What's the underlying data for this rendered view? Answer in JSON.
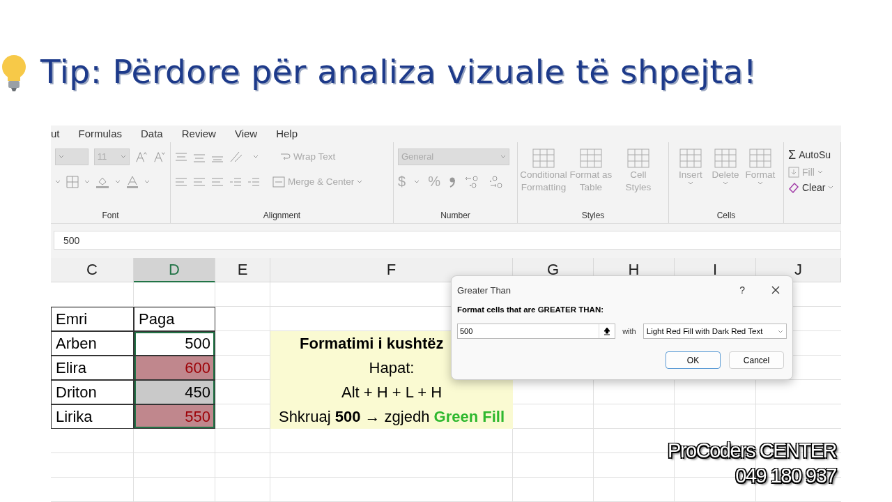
{
  "title": "Tip: Përdore për analiza vizuale të shpejta!",
  "ribbon": {
    "tabs": [
      "ut",
      "Formulas",
      "Data",
      "Review",
      "View",
      "Help"
    ],
    "groups": [
      {
        "kind": "font",
        "label": "Font",
        "size": "11"
      },
      {
        "kind": "alignment",
        "label": "Alignment",
        "buttons": [
          "Wrap Text",
          "Merge & Center"
        ]
      },
      {
        "kind": "number",
        "label": "Number",
        "format": "General",
        "symbols": [
          "$",
          "%"
        ]
      },
      {
        "kind": "styles",
        "label": "Styles",
        "buttons": [
          "Conditional Formatting",
          "Format as Table",
          "Cell Styles"
        ]
      },
      {
        "kind": "cells",
        "label": "Cells",
        "buttons": [
          "Insert",
          "Delete",
          "Format"
        ]
      },
      {
        "kind": "editing",
        "sigma": "Σ",
        "buttons": [
          "AutoSu",
          "Fill",
          "Clear"
        ]
      }
    ]
  },
  "formula_bar": {
    "value": "500"
  },
  "sheet": {
    "columns": [
      {
        "label": "C",
        "selected": false
      },
      {
        "label": "D",
        "selected": true
      },
      {
        "label": "E",
        "selected": false
      },
      {
        "label": "F",
        "selected": false
      },
      {
        "label": "G",
        "selected": false
      },
      {
        "label": "H",
        "selected": false
      },
      {
        "label": "I",
        "selected": false
      },
      {
        "label": "J",
        "selected": false
      }
    ],
    "table": {
      "header": [
        "Emri",
        "Paga"
      ],
      "rows": [
        {
          "name": "Arben",
          "salary": "500",
          "highlighted": false,
          "color": "#ffffff"
        },
        {
          "name": "Elira",
          "salary": "600",
          "highlighted": true,
          "color": "#c0878d"
        },
        {
          "name": "Driton",
          "salary": "450",
          "highlighted": false,
          "color": "#c9c9c9"
        },
        {
          "name": "Lirika",
          "salary": "550",
          "highlighted": true,
          "color": "#c0878d"
        }
      ]
    },
    "notes": [
      {
        "kind": "heading",
        "text": "Formatimi i kushtëz"
      },
      {
        "kind": "plain",
        "text": "Hapat:"
      },
      {
        "kind": "plain",
        "text": "Alt + H + L + H"
      },
      {
        "kind": "plain",
        "text": "Shkruaj **500** → zgjedh ",
        "accent": "Green Fill"
      }
    ]
  },
  "dialog": {
    "title": "Greater Than",
    "help": "?",
    "prompt": "Format cells that are GREATER THAN:",
    "value": "500",
    "with": "with",
    "format": "Light Red Fill with Dark Red Text",
    "buttons": [
      {
        "label": "OK",
        "selected": true
      },
      {
        "label": "Cancel",
        "selected": false
      }
    ]
  },
  "caption": [
    "ProCoders CENTER",
    "049 180 937"
  ]
}
